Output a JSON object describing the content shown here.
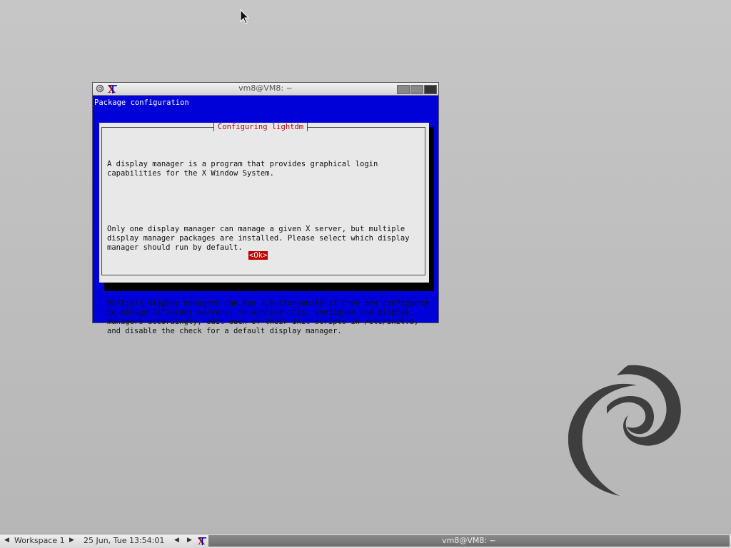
{
  "window": {
    "title": "vm8@VM8: ~"
  },
  "terminal": {
    "backtitle": "Package configuration",
    "dialog": {
      "title": "Configuring lightdm",
      "paragraphs": [
        "A display manager is a program that provides graphical login\ncapabilities for the X Window System.",
        "Only one display manager can manage a given X server, but multiple\ndisplay manager packages are installed. Please select which display\nmanager should run by default.",
        "Multiple display managers can run simultaneously if they are configured\nto manage different servers; to achieve this, configure the display\nmanagers accordingly, edit each of their init scripts in /etc/init.d,\nand disable the check for a default display manager."
      ],
      "ok_label": "<Ok>"
    }
  },
  "taskbar": {
    "workspace": "Workspace 1",
    "clock": "25 Jun, Tue 13:54:01",
    "task_title": "vm8@VM8: ~"
  },
  "colors": {
    "terminal_bg": "#0000d8",
    "dialog_bg": "#e8e8e8",
    "dialog_title": "#b00000",
    "ok_button": "#c00000"
  },
  "icons": {
    "window_menu": "debian-swirl-icon",
    "app": "xterm-icon",
    "desktop_logo": "debian-swirl-logo"
  }
}
